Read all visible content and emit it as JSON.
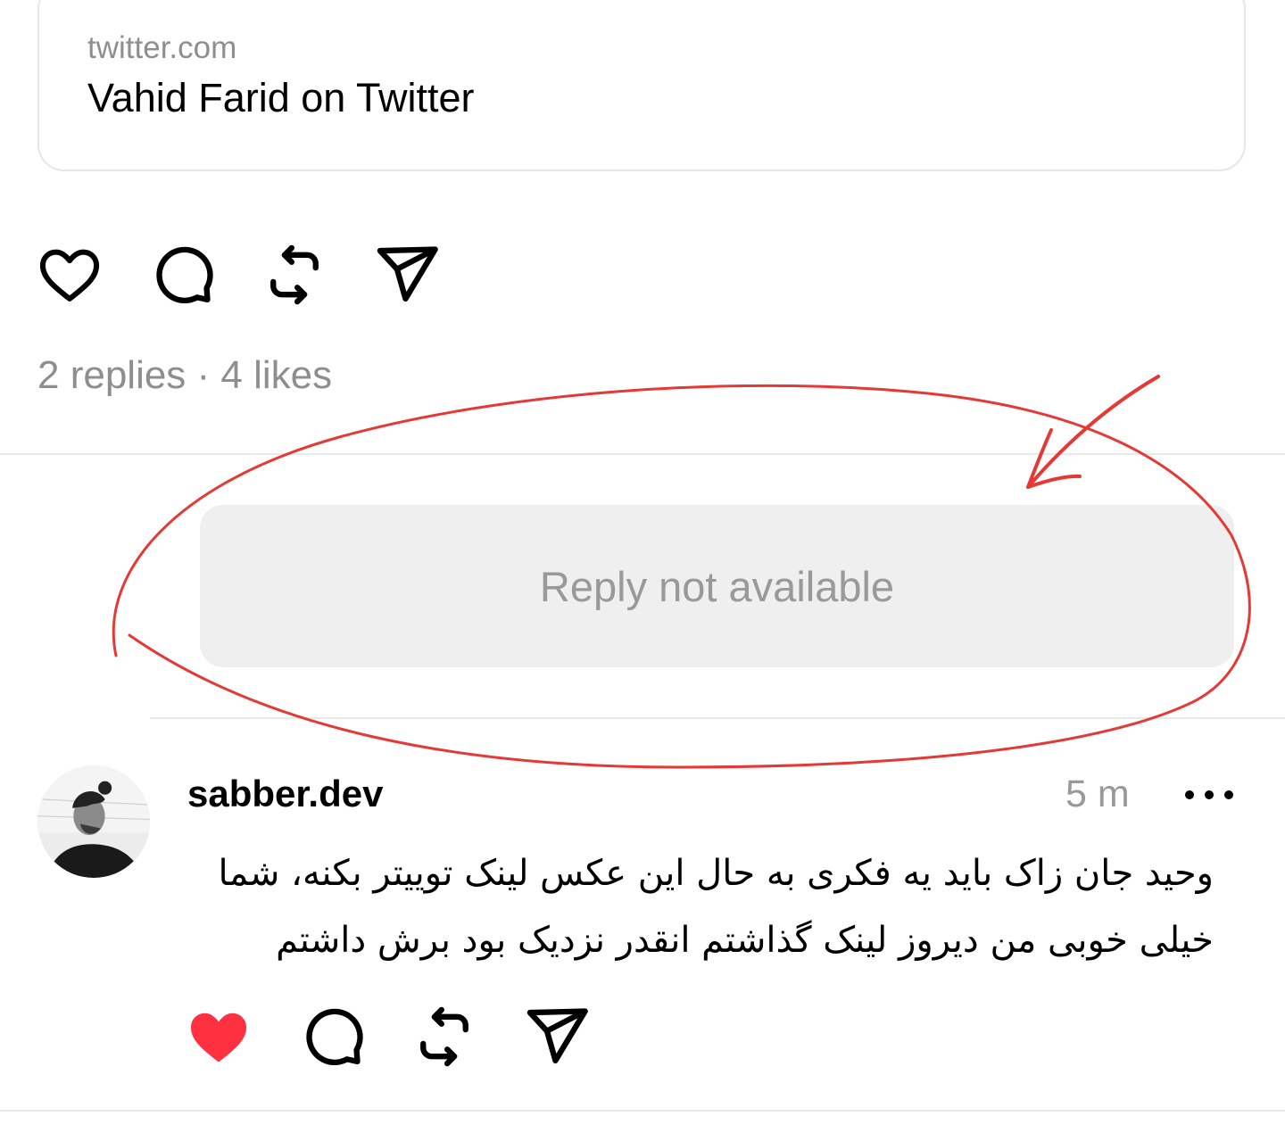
{
  "link_card": {
    "domain": "twitter.com",
    "title": "Vahid Farid on Twitter"
  },
  "post_actions": {
    "like_icon": "heart-outline-icon",
    "comment_icon": "comment-bubble-icon",
    "repost_icon": "repost-arrows-icon",
    "share_icon": "send-paper-plane-icon"
  },
  "post_stats": "2 replies · 4 likes",
  "unavailable_reply": "Reply not available",
  "reply": {
    "username": "sabber.dev",
    "timestamp": "5 m",
    "text": "وحید جان زاک باید یه فکری به حال این عکس لینک توییتر بکنه، شما خیلی خوبی من دیروز لینک گذاشتم انقدر نزدیک بود برش داشتم",
    "liked": true,
    "like_color": "#ff3040"
  },
  "annotation_color": "#e53935"
}
